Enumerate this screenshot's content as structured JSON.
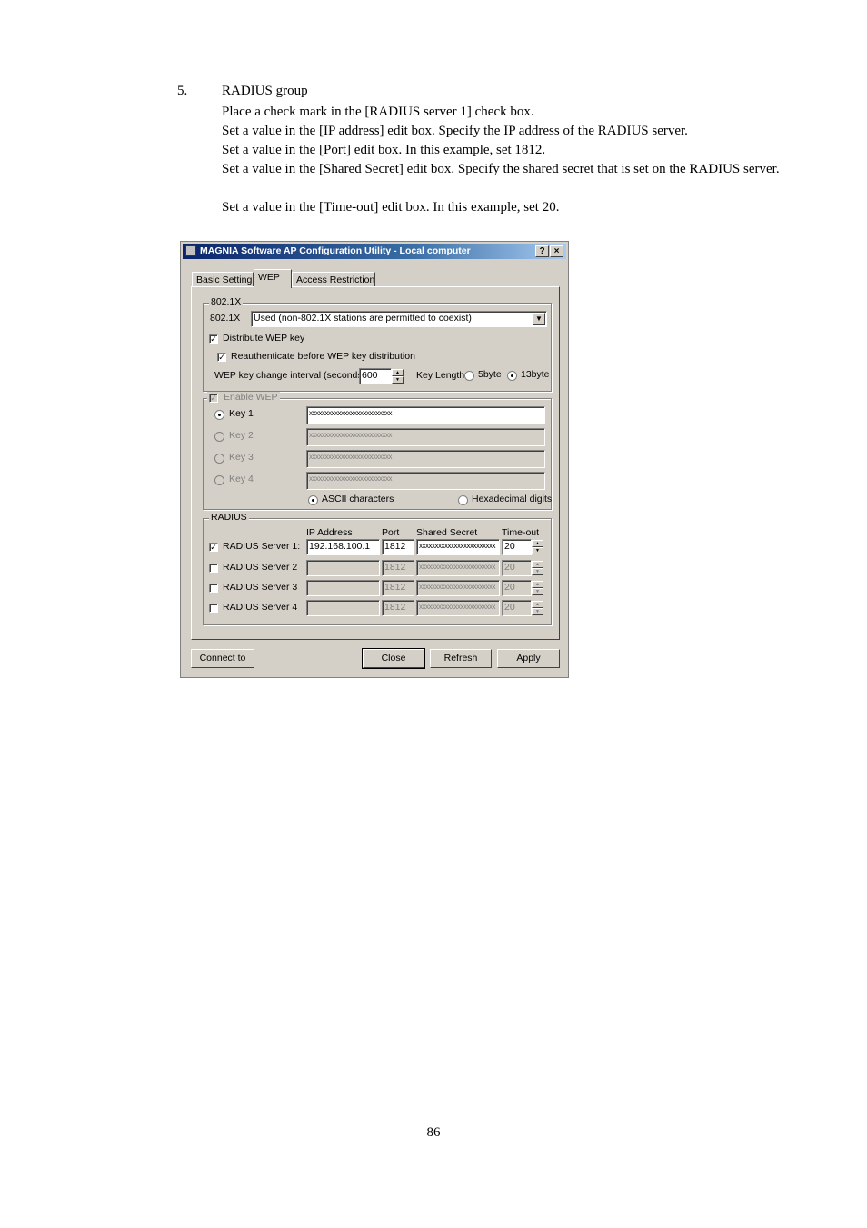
{
  "document": {
    "step_number": "5.",
    "step_title": "RADIUS group",
    "instructions": [
      "Place a check mark in the [RADIUS server 1] check box.",
      "Set a value in the [IP address] edit box.  Specify the IP address of the RADIUS server.",
      "Set a value in the [Port] edit box.  In this example, set 1812.",
      "Set a value in the [Shared Secret] edit box.  Specify the shared secret that is set on the RADIUS server.",
      "Set a value in the [Time-out] edit box.  In this example, set 20."
    ],
    "page_number": "86"
  },
  "dialog": {
    "title": "MAGNIA Software AP Configuration Utility - Local computer",
    "help_button": "?",
    "close_button": "×",
    "tabs": [
      {
        "label": "Basic Setting"
      },
      {
        "label": "WEP"
      },
      {
        "label": "Access Restriction"
      }
    ],
    "group_8021x": {
      "title": "802.1X",
      "mode_label": "802.1X",
      "mode_value": "Used (non-802.1X stations are permitted to coexist)",
      "distribute_label": "Distribute WEP key",
      "reauth_label": "Reauthenticate before WEP key distribution",
      "interval_label": "WEP key change interval (seconds)",
      "interval_value": "600",
      "key_length_label": "Key Length",
      "opt_5byte": "5byte",
      "opt_13byte": "13byte",
      "selected_key_length": "13byte"
    },
    "group_wep": {
      "title": "Enable WEP",
      "keys": [
        {
          "label": "Key 1",
          "value": "xxxxxxxxxxxxxxxxxxxxxxxxxx"
        },
        {
          "label": "Key 2",
          "value": "xxxxxxxxxxxxxxxxxxxxxxxxxx"
        },
        {
          "label": "Key 3",
          "value": "xxxxxxxxxxxxxxxxxxxxxxxxxx"
        },
        {
          "label": "Key 4",
          "value": "xxxxxxxxxxxxxxxxxxxxxxxxxx"
        }
      ],
      "ascii_label": "ASCII characters",
      "hex_label": "Hexadecimal digits"
    },
    "group_radius": {
      "title": "RADIUS",
      "col_ip": "IP Address",
      "col_port": "Port",
      "col_secret": "Shared Secret",
      "col_timeout": "Time-out",
      "servers": [
        {
          "label": "RADIUS Server 1:",
          "ip": "192.168.100.1",
          "port": "1812",
          "secret": "xxxxxxxxxxxxxxxxxxxxxxxx",
          "timeout": "20",
          "checked": true
        },
        {
          "label": "RADIUS Server 2",
          "ip": "",
          "port": "1812",
          "secret": "xxxxxxxxxxxxxxxxxxxxxxxx",
          "timeout": "20",
          "checked": false
        },
        {
          "label": "RADIUS Server 3",
          "ip": "",
          "port": "1812",
          "secret": "xxxxxxxxxxxxxxxxxxxxxxxx",
          "timeout": "20",
          "checked": false
        },
        {
          "label": "RADIUS Server 4",
          "ip": "",
          "port": "1812",
          "secret": "xxxxxxxxxxxxxxxxxxxxxxxx",
          "timeout": "20",
          "checked": false
        }
      ]
    },
    "buttons": {
      "connect": "Connect to",
      "close": "Close",
      "refresh": "Refresh",
      "apply": "Apply"
    },
    "check_mark": "✓",
    "dropdown_arrow": "▼",
    "spin_up": "▲",
    "spin_down": "▼"
  }
}
